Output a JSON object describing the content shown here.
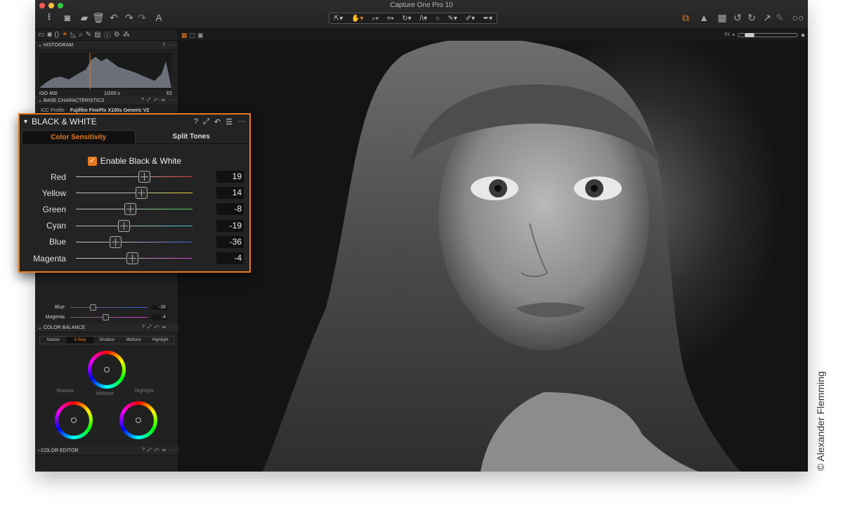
{
  "app": {
    "title": "Capture One Pro 10"
  },
  "toolbar": {
    "left_icons": [
      "import-icon",
      "camera-icon",
      "folder-icon",
      "trash-icon",
      "undo-icon",
      "redo-icon",
      "text-icon"
    ],
    "cursor_tools": [
      "select-cursor-icon",
      "pan-cursor-icon",
      "loupe-cursor-icon",
      "crop-cursor-icon",
      "rotate-cursor-icon",
      "keystone-cursor-icon",
      "spot-cursor-icon",
      "brush-cursor-icon",
      "eraser-cursor-icon",
      "picker-cursor-icon"
    ],
    "right_icons": [
      "layers-icon",
      "warning-icon",
      "grid-icon",
      "rotate-left-icon",
      "rotate-right-icon",
      "expand-icon",
      "edit-icon",
      "glasses-icon"
    ]
  },
  "sidebar": {
    "tool_tabs": [
      "library-icon",
      "capture-icon",
      "lens-icon",
      "color-icon",
      "exposure-icon",
      "details-icon",
      "adjustments-icon",
      "metadata-icon",
      "output-icon",
      "settings-icon",
      "batch-icon"
    ],
    "histogram": {
      "title": "HISTOGRAM",
      "iso": "ISO 400",
      "shutter": "1/200 s",
      "aperture": "f/2"
    },
    "base_characteristics": {
      "title": "BASE CHARACTERISTICS",
      "icc_label": "ICC Profile",
      "icc_value": "Fujifilm FinePix X100s Generic V2"
    },
    "mini_bw": [
      {
        "name": "Blue",
        "value": "-36"
      },
      {
        "name": "Magenta",
        "value": "-4"
      }
    ],
    "color_balance": {
      "title": "COLOR BALANCE",
      "tabs": [
        "Master",
        "3-Way",
        "Shadow",
        "Midtone",
        "Highlight"
      ],
      "active_tab": "3-Way",
      "wheel_labels": {
        "shadow": "Shadow",
        "midtone": "Midtone",
        "highlight": "Highlight"
      }
    },
    "color_editor": {
      "title": "COLOR EDITOR"
    },
    "head_controls": "? ⤢ ↶ ☰ ···"
  },
  "viewer": {
    "fit_label": "Fit",
    "zoom_level": 0.12
  },
  "bw_panel": {
    "title": "BLACK & WHITE",
    "controls": [
      "?",
      "⤢",
      "↶",
      "☰",
      "···"
    ],
    "tabs": [
      "Color Sensitivity",
      "Split Tones"
    ],
    "active_tab": "Color Sensitivity",
    "enable_label": "Enable Black & White",
    "enabled": true,
    "sliders": [
      {
        "name": "Red",
        "value": "19",
        "color": "#e23b3b"
      },
      {
        "name": "Yellow",
        "value": "14",
        "color": "#e2d52e"
      },
      {
        "name": "Green",
        "value": "-8",
        "color": "#3fd14a"
      },
      {
        "name": "Cyan",
        "value": "-19",
        "color": "#34c9cf"
      },
      {
        "name": "Blue",
        "value": "-36",
        "color": "#3d5de0"
      },
      {
        "name": "Magenta",
        "value": "-4",
        "color": "#d23fd0"
      }
    ]
  },
  "credit": "© Alexander Flemming",
  "colors": {
    "accent": "#e8791c",
    "background": "#1b1b1b"
  }
}
